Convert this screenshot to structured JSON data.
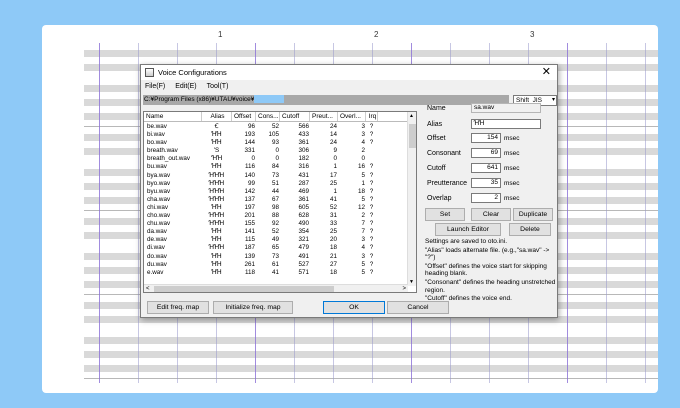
{
  "ruler": {
    "marks": [
      "1",
      "2",
      "3"
    ]
  },
  "dialog": {
    "title": "Voice Configurations",
    "close_glyph": "✕",
    "menu": [
      "File(F)",
      "Edit(E)",
      "Tool(T)"
    ],
    "path": "C:¥Program Files (x86)¥UTAU¥voice¥",
    "encoding": "Shift_JIS",
    "encoding_arrow": "▾",
    "list": {
      "columns": [
        "Name",
        "Alias",
        "Offset",
        "Cons...",
        "Cutoff",
        "Preut...",
        "Overl...",
        "Irq"
      ],
      "rows": [
        [
          "be.wav",
          "Ꞓ",
          "96",
          "52",
          "566",
          "24",
          "3",
          "?"
        ],
        [
          "bi.wav",
          "ꞪꞪ",
          "193",
          "105",
          "433",
          "14",
          "3",
          "?"
        ],
        [
          "bo.wav",
          "ꞪꞪ",
          "144",
          "93",
          "361",
          "24",
          "4",
          "?"
        ],
        [
          "breath.wav",
          "'S",
          "331",
          "0",
          "306",
          "9",
          "2",
          ""
        ],
        [
          "breath_out.wav",
          "'ꞪꞪ",
          "0",
          "0",
          "182",
          "0",
          "0",
          ""
        ],
        [
          "bu.wav",
          "ꞪꞪ",
          "116",
          "84",
          "316",
          "1",
          "16",
          "?"
        ],
        [
          "bya.wav",
          "ꞪꞪꞪ",
          "140",
          "73",
          "431",
          "17",
          "5",
          "?"
        ],
        [
          "byo.wav",
          "ꞪꞪꞪ",
          "99",
          "51",
          "287",
          "25",
          "1",
          "?"
        ],
        [
          "byu.wav",
          "ꞪꞪꞪ",
          "142",
          "44",
          "469",
          "1",
          "18",
          "?"
        ],
        [
          "cha.wav",
          "ꞪꞪꞪ",
          "137",
          "67",
          "361",
          "41",
          "5",
          "?"
        ],
        [
          "chi.wav",
          "ꞪꞪ",
          "197",
          "98",
          "605",
          "52",
          "12",
          "?"
        ],
        [
          "cho.wav",
          "ꞪꞪꞪ",
          "201",
          "88",
          "628",
          "31",
          "2",
          "?"
        ],
        [
          "chu.wav",
          "ꞪꞪꞪ",
          "155",
          "92",
          "490",
          "33",
          "7",
          "?"
        ],
        [
          "da.wav",
          "ꞪꞪ",
          "141",
          "52",
          "354",
          "25",
          "7",
          "?"
        ],
        [
          "de.wav",
          "ꞪꞪ",
          "115",
          "49",
          "321",
          "20",
          "3",
          "?"
        ],
        [
          "di.wav",
          "ꞪꞪꞪ",
          "187",
          "65",
          "479",
          "18",
          "4",
          "?"
        ],
        [
          "do.wav",
          "ꞪꞪ",
          "139",
          "73",
          "491",
          "21",
          "3",
          "?"
        ],
        [
          "du.wav",
          "ꞪꞪ",
          "261",
          "61",
          "527",
          "27",
          "5",
          "?"
        ],
        [
          "e.wav",
          "ꞪꞪ",
          "118",
          "41",
          "571",
          "18",
          "5",
          "?"
        ]
      ],
      "scroll_left": "<",
      "scroll_right": ">",
      "scroll_up": "▲",
      "scroll_down": "▼"
    },
    "fields": {
      "name_label": "Name",
      "name_value": "sa.wav",
      "alias_label": "Alias",
      "alias_value": "ꞪꞪ",
      "offset_label": "Offset",
      "offset_value": "154",
      "offset_unit": "msec",
      "consonant_label": "Consonant",
      "consonant_value": "69",
      "consonant_unit": "msec",
      "cutoff_label": "Cutoff",
      "cutoff_value": "641",
      "cutoff_unit": "msec",
      "preutterance_label": "Preutterance",
      "preutterance_value": "35",
      "preutterance_unit": "msec",
      "overlap_label": "Overlap",
      "overlap_value": "2",
      "overlap_unit": "msec"
    },
    "buttons": {
      "set": "Set",
      "clear": "Clear",
      "duplicate": "Duplicate",
      "launch_editor": "Launch Editor",
      "delete": "Delete",
      "edit_freq_map": "Edit freq. map",
      "init_freq_map": "Initialize freq. map",
      "ok": "OK",
      "cancel": "Cancel"
    },
    "info": [
      "Settings are saved to oto.ini.",
      "\"Alias\" loads alternate file. (e.g.,\"sa.wav\" -> \"?\")",
      "\"Offset\" defines the voice start for skipping heading blank.",
      "\"Consonant\" defines the heading unstretched region.",
      "\"Cutoff\" defines the voice end."
    ]
  },
  "colors": {
    "background": "#8ec9f7",
    "grid_dark_row": "#d9d9d9",
    "bar_line": "#8a6fd6",
    "path_bar": "#a8a8a8"
  }
}
